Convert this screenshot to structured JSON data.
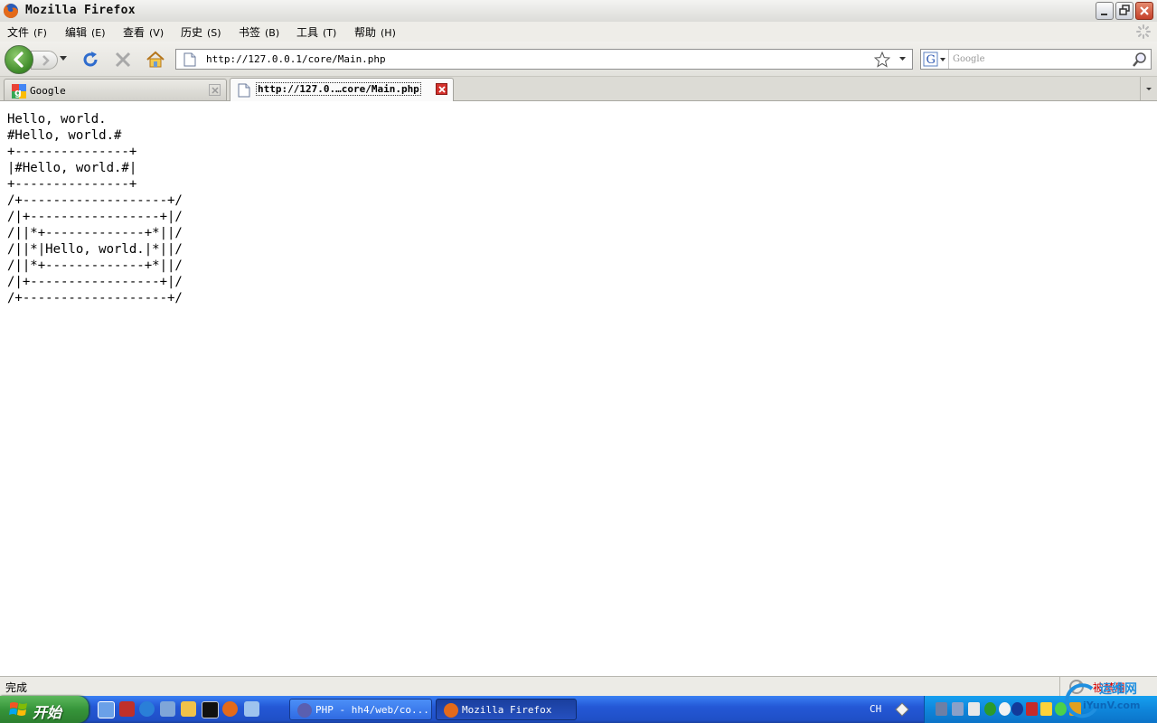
{
  "window": {
    "title": "Mozilla Firefox",
    "buttons": [
      "minimize-icon",
      "restore-icon",
      "close-icon"
    ]
  },
  "menu": [
    {
      "label": "文件",
      "accel": "(F)"
    },
    {
      "label": "编辑",
      "accel": "(E)"
    },
    {
      "label": "查看",
      "accel": "(V)"
    },
    {
      "label": "历史",
      "accel": "(S)"
    },
    {
      "label": "书签",
      "accel": "(B)"
    },
    {
      "label": "工具",
      "accel": "(T)"
    },
    {
      "label": "帮助",
      "accel": "(H)"
    }
  ],
  "navbar": {
    "url": "http://127.0.0.1/core/Main.php",
    "search_placeholder": "Google"
  },
  "tabs": [
    {
      "label": "Google",
      "active": false
    },
    {
      "label": "http://127.0.…core/Main.php",
      "active": true
    }
  ],
  "content": {
    "output": "Hello, world.\n#Hello, world.#\n+---------------+\n|#Hello, world.#|\n+---------------+\n/+-------------------+/\n/|+-----------------+|/\n/||*+-------------+*||/\n/||*|Hello, world.|*||/\n/||*+-------------+*||/\n/|+-----------------+|/\n/+-------------------+/"
  },
  "statusbar": {
    "status": "完成",
    "noscript": "被禁用"
  },
  "taskbar": {
    "start_label": "开始",
    "tasks": [
      {
        "label": "PHP - hh4/web/co...",
        "active": false
      },
      {
        "label": "Mozilla Firefox",
        "active": true
      }
    ],
    "language": "CH"
  },
  "watermark": {
    "title": "运维网",
    "url": "iYunV.com"
  },
  "colors": {
    "taskbar_blue": "#245edb",
    "start_green": "#36953a",
    "tray_blue": "#0f86db",
    "noscript_red": "#d40000"
  }
}
